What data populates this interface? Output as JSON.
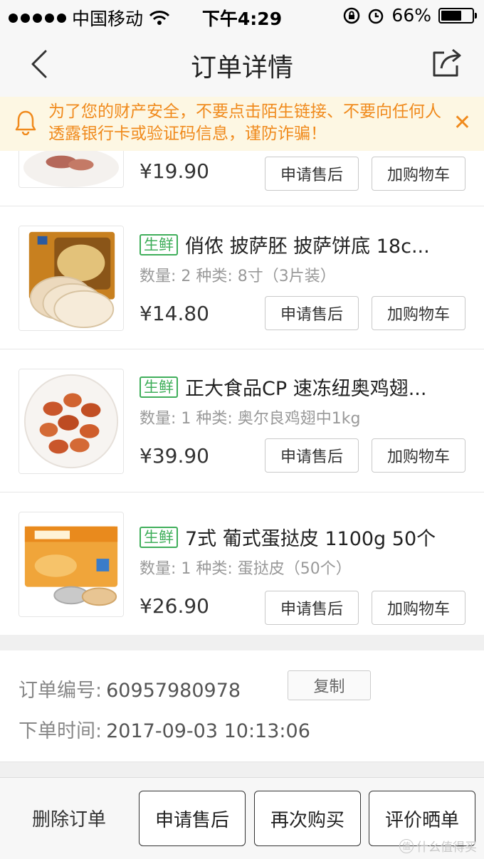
{
  "status_bar": {
    "carrier": "中国移动",
    "time": "下午4:29",
    "battery": "66%",
    "battery_level": 0.66,
    "icons": [
      "signal-dots-icon",
      "wifi-icon",
      "orientation-lock-icon",
      "alarm-icon",
      "battery-icon"
    ]
  },
  "nav": {
    "title": "订单详情",
    "back_icon": "chevron-left-icon",
    "share_icon": "share-icon"
  },
  "notice": {
    "text": "为了您的财产安全，不要点击陌生链接、不要向任何人透露银行卡或验证码信息，谨防诈骗！",
    "close": "✕",
    "icon": "bell-icon"
  },
  "items": [
    {
      "tag": "",
      "name": "",
      "spec": "",
      "price": "¥19.90",
      "after_sale": "申请售后",
      "add_cart": "加购物车"
    },
    {
      "tag": "生鲜",
      "name": "俏侬 披萨胚 披萨饼底 18c...",
      "spec": "数量: 2 种类: 8寸（3片装）",
      "price": "¥14.80",
      "after_sale": "申请售后",
      "add_cart": "加购物车"
    },
    {
      "tag": "生鲜",
      "name": "正大食品CP 速冻纽奥鸡翅...",
      "spec": "数量: 1 种类: 奥尔良鸡翅中1kg",
      "price": "¥39.90",
      "after_sale": "申请售后",
      "add_cart": "加购物车"
    },
    {
      "tag": "生鲜",
      "name": "7式 葡式蛋挞皮 1100g 50个",
      "spec": "数量: 1 种类: 蛋挞皮（50个）",
      "price": "¥26.90",
      "after_sale": "申请售后",
      "add_cart": "加购物车"
    }
  ],
  "order": {
    "number_label": "订单编号:",
    "number": "60957980978",
    "copy": "复制",
    "time_label": "下单时间:",
    "time": "2017-09-03 10:13:06"
  },
  "bottom": {
    "delete": "删除订单",
    "after_sale": "申请售后",
    "rebuy": "再次购买",
    "review": "评价晒单",
    "watermark": "什么值得买",
    "watermark_badge": "值"
  },
  "colors": {
    "accent_green": "#3fae5a",
    "notice_orange": "#f08a1c",
    "notice_bg": "#fdf7e3"
  }
}
